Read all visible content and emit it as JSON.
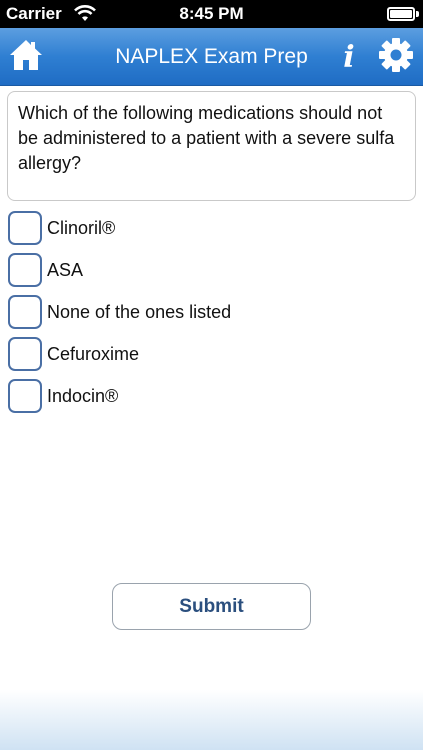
{
  "status_bar": {
    "carrier": "Carrier",
    "time": "8:45 PM",
    "wifi_icon": "wifi-icon",
    "battery_icon": "battery-icon"
  },
  "nav_bar": {
    "title": "NAPLEX Exam Prep",
    "home_icon": "home-icon",
    "info_icon": "info-icon",
    "info_glyph": "i",
    "settings_icon": "gear-icon",
    "color": "#2f7fd2"
  },
  "question": {
    "text": "Which of the following medications should not be administered to a patient with a severe sulfa allergy?"
  },
  "options": [
    {
      "label": "Clinoril®",
      "checked": false
    },
    {
      "label": "ASA",
      "checked": false
    },
    {
      "label": "None of the ones listed",
      "checked": false
    },
    {
      "label": "Cefuroxime",
      "checked": false
    },
    {
      "label": "Indocin®",
      "checked": false
    }
  ],
  "submit": {
    "label": "Submit"
  }
}
